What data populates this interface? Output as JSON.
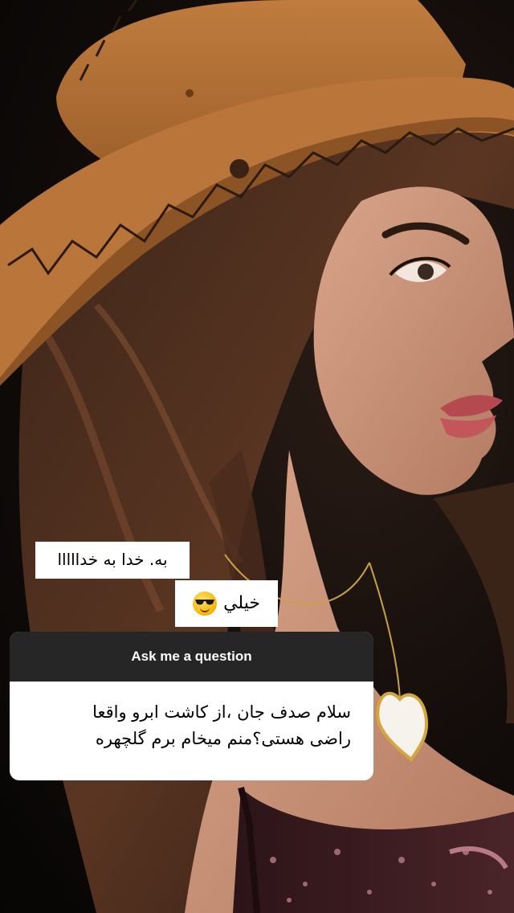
{
  "stickers": {
    "line1": "به. خدا به خدااااا",
    "line2": "خيلي",
    "line2_emoji": "smiling-face-with-sunglasses-icon"
  },
  "question_box": {
    "header": "Ask me a question",
    "question_line1": "سلام صدف جان ،از کاشت ابرو واقعا",
    "question_line2": "راضی هستی؟منم میخام برم گلچهره"
  },
  "colors": {
    "header_bg": "#262626",
    "card_bg": "#ffffff",
    "sticker_bg": "#ffffff",
    "hat": "#b8753a",
    "background": "#0b0908"
  }
}
